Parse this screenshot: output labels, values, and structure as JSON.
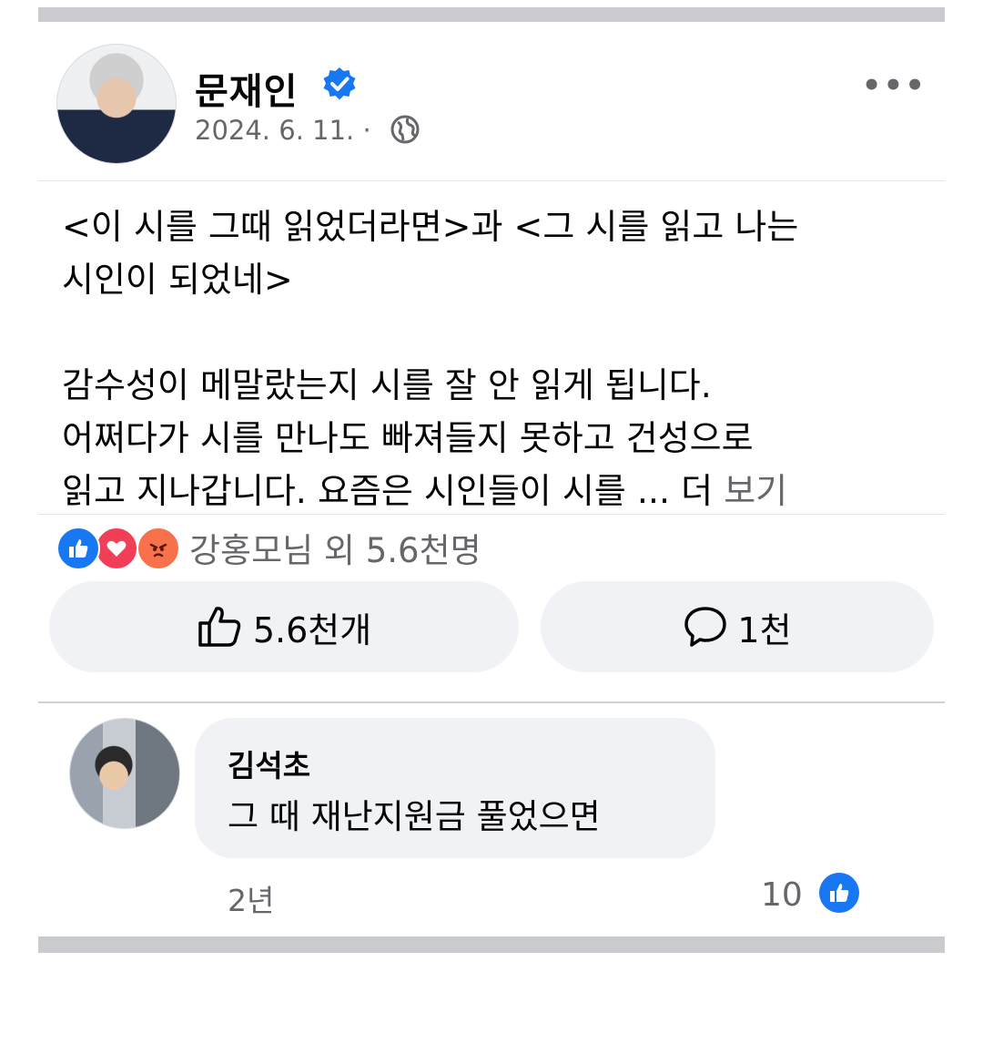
{
  "post": {
    "author": "문재인",
    "date": "2024. 6. 11. ·",
    "text_lines": "<이 시를 그때 읽었더라면>과 <그 시를 읽고 나는\n시인이 되었네>\n\n감수성이 메말랐는지 시를 잘 안 읽게 됩니다.\n어쩌다가 시를 만나도 빠져들지 못하고 건성으로\n읽고 지나갑니다. 요즘은 시인들이 시를 ... 더 ",
    "see_more": "보기",
    "more_icon": "•••"
  },
  "reactions": {
    "summary": "강홍모님 외 5.6천명",
    "icons": [
      "like-icon",
      "love-icon",
      "angry-icon"
    ]
  },
  "actions": {
    "like_count": "5.6천개",
    "comment_count": "1천"
  },
  "comment": {
    "author": "김석초",
    "text": "그 때 재난지원금 풀었으면",
    "time": "2년",
    "likes": "10"
  },
  "colors": {
    "accent": "#1877f2",
    "muted": "#65676b",
    "bubble": "#f0f2f5",
    "love": "#f33e58",
    "angry": "#f7714c"
  }
}
